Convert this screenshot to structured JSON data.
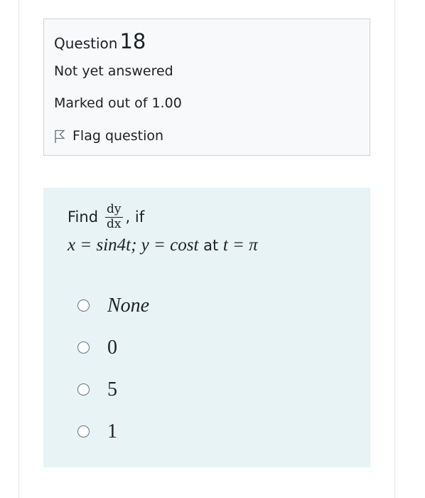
{
  "question_info": {
    "label": "Question",
    "number": "18",
    "status": "Not yet answered",
    "grade": "Marked out of 1.00",
    "flag_label": "Flag question"
  },
  "question": {
    "find_label": "Find",
    "frac_numerator": "dy",
    "frac_denominator": "dx",
    "if_label": ", if",
    "eq_x": "x = sin4t; y = cost",
    "at_label": " at ",
    "eq_t": "t = π"
  },
  "options": [
    {
      "label": "None"
    },
    {
      "label": "0"
    },
    {
      "label": "5"
    },
    {
      "label": "1"
    }
  ]
}
